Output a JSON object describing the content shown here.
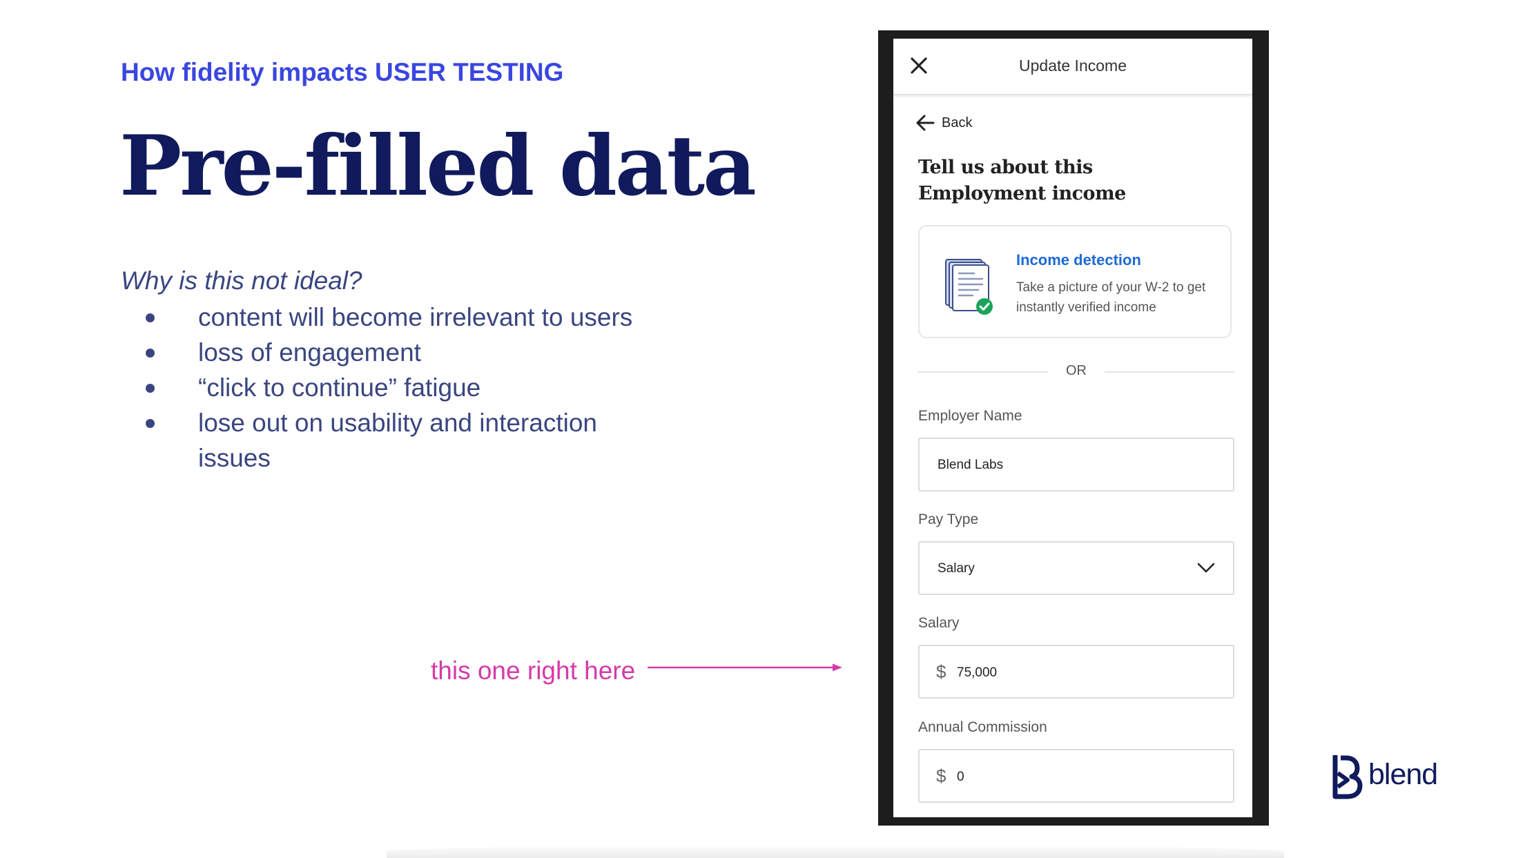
{
  "slide": {
    "eyebrow": "How fidelity impacts USER TESTING",
    "title": "Pre-filled data",
    "question": "Why is this not ideal?",
    "bullets": [
      "content will become irrelevant to users",
      "loss of engagement",
      "“click to continue” fatigue",
      "lose out on usability and interaction issues"
    ],
    "annotation": "this one right here",
    "logo_text": "blend",
    "colors": {
      "eyebrow": "#3a46e0",
      "title": "#101a5c",
      "body": "#3a4580",
      "annotation": "#d63aa8",
      "link": "#1b6ad6",
      "success": "#1aa35a"
    }
  },
  "phone": {
    "header_title": "Update Income",
    "close_icon": "close-icon",
    "back_label": "Back",
    "heading": "Tell us about this Employment income",
    "income_detection": {
      "title": "Income detection",
      "description": "Take a picture of your W-2 to get instantly verified income",
      "icon": "document-check-icon"
    },
    "or_label": "OR",
    "employer_name": {
      "label": "Employer Name",
      "value": "Blend Labs"
    },
    "pay_type": {
      "label": "Pay Type",
      "value": "Salary"
    },
    "salary": {
      "label": "Salary",
      "currency": "$",
      "value": "75,000"
    },
    "annual_commission": {
      "label": "Annual Commission",
      "currency": "$",
      "value": "0"
    }
  }
}
